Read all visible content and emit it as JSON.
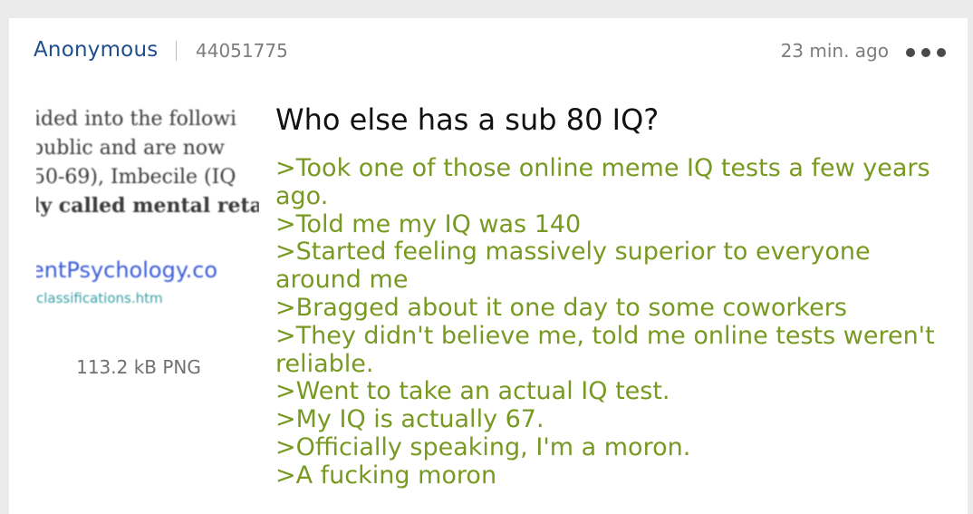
{
  "post": {
    "author": "Anonymous",
    "id": "44051775",
    "time": "23 min. ago",
    "title": "Who else has a sub 80 IQ?",
    "lines": [
      ">Took one of those online meme IQ tests a few years ago.",
      ">Told me my IQ was 140",
      ">Started feeling massively superior to everyone around me",
      ">Bragged about it one day to some coworkers",
      ">They didn't believe me, told me online tests weren't reliable.",
      ">Went to take an actual IQ test.",
      ">My IQ is actually 67.",
      ">Officially speaking, I'm a moron.",
      ">A fucking moron"
    ]
  },
  "attachment": {
    "file_info": "113.2 kB PNG",
    "image_text": [
      "ided into the followi",
      "public and are now",
      "50-69), Imbecile (IQ",
      "ly called mental reta",
      "entPsychology.co",
      "classifications.htm"
    ]
  },
  "colors": {
    "greentext": "#789922",
    "author": "#1f4e8c",
    "meta": "#7d7d7d",
    "background": "#ebebeb",
    "card": "#ffffff"
  },
  "icons": {
    "more": "more-options-icon"
  }
}
